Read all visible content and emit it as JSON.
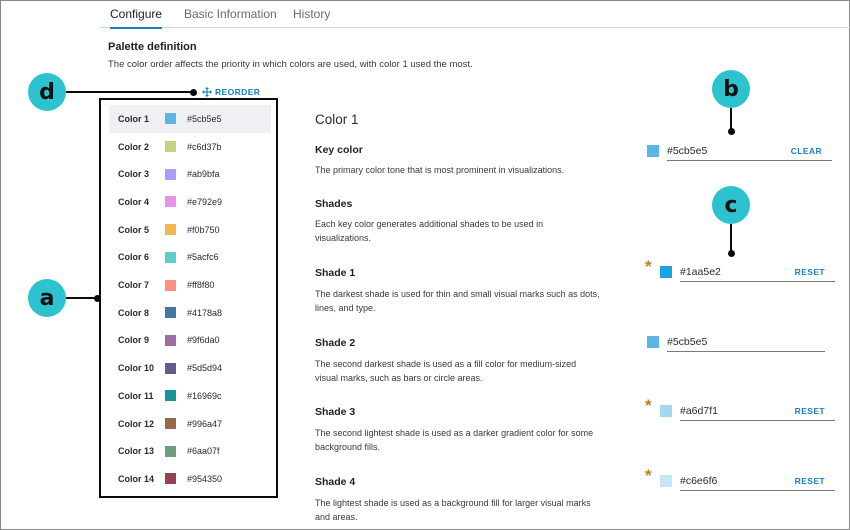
{
  "tabs": [
    "Configure",
    "Basic Information",
    "History"
  ],
  "palette": {
    "title": "Palette definition",
    "description": "The color order affects the priority in which colors are used, with color 1 used the most.",
    "reorder_label": "REORDER"
  },
  "colors": [
    {
      "label": "Color 1",
      "hex": "#5cb5e5"
    },
    {
      "label": "Color 2",
      "hex": "#c6d37b"
    },
    {
      "label": "Color 3",
      "hex": "#ab9bfa"
    },
    {
      "label": "Color 4",
      "hex": "#e792e9"
    },
    {
      "label": "Color 5",
      "hex": "#f0b750"
    },
    {
      "label": "Color 6",
      "hex": "#5acfc6"
    },
    {
      "label": "Color 7",
      "hex": "#ff8f80"
    },
    {
      "label": "Color 8",
      "hex": "#4178a8"
    },
    {
      "label": "Color 9",
      "hex": "#9f6da0"
    },
    {
      "label": "Color 10",
      "hex": "#5d5d94"
    },
    {
      "label": "Color 11",
      "hex": "#16969c"
    },
    {
      "label": "Color 12",
      "hex": "#996a47"
    },
    {
      "label": "Color 13",
      "hex": "#6aa07f"
    },
    {
      "label": "Color 14",
      "hex": "#954350"
    }
  ],
  "detail": {
    "heading": "Color 1",
    "key_color": {
      "title": "Key color",
      "description": "The primary color tone that is most prominent in visualizations.",
      "value": "#5cb5e5",
      "action": "CLEAR"
    },
    "shades_intro": {
      "title": "Shades",
      "description": "Each key color generates additional shades to be used in visualizations."
    },
    "shades": [
      {
        "title": "Shade 1",
        "description": "The darkest shade is used for thin and small visual marks such as dots, lines, and type.",
        "value": "#1aa5e2",
        "action": "RESET",
        "modified": true
      },
      {
        "title": "Shade 2",
        "description": "The second darkest shade is used as a fill color for medium-sized visual marks, such as bars or circle areas.",
        "value": "#5cb5e5",
        "action": "",
        "modified": false
      },
      {
        "title": "Shade 3",
        "description": "The second lightest shade is used as a darker gradient color for some background fills.",
        "value": "#a6d7f1",
        "action": "RESET",
        "modified": true
      },
      {
        "title": "Shade 4",
        "description": "The lightest shade is used as a background fill for larger visual marks and areas.",
        "value": "#c6e6f6",
        "action": "RESET",
        "modified": true
      }
    ]
  },
  "callouts": [
    "a",
    "b",
    "c",
    "d"
  ],
  "icons": {
    "reorder": "move-arrows-icon"
  },
  "accent_color": "#1b7fbf"
}
